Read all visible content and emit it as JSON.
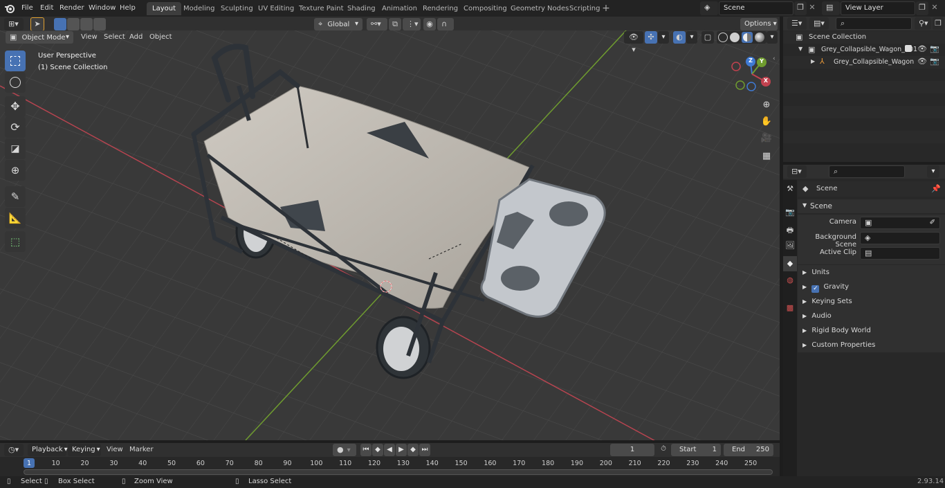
{
  "topbar": {
    "menus": [
      "File",
      "Edit",
      "Render",
      "Window",
      "Help"
    ],
    "workspaces": [
      "Layout",
      "Modeling",
      "Sculpting",
      "UV Editing",
      "Texture Paint",
      "Shading",
      "Animation",
      "Rendering",
      "Compositing",
      "Geometry Nodes",
      "Scripting"
    ],
    "active_workspace": "Layout",
    "scene_name": "Scene",
    "view_layer": "View Layer"
  },
  "viewport_header": {
    "mode": "Object Mode",
    "menus": [
      "View",
      "Select",
      "Add",
      "Object"
    ],
    "transform_orientation": "Global",
    "options_label": "Options"
  },
  "viewport": {
    "overlay_line1": "User Perspective",
    "overlay_line2": "(1) Scene Collection",
    "gizmo_axes": [
      "Z",
      "Y",
      "X"
    ],
    "colors": {
      "x_axis": "#c2424f",
      "y_axis": "#6f9c2f",
      "z_axis": "#3f7ad3",
      "active_tool": "#4772b3"
    }
  },
  "outliner": {
    "root": "Scene Collection",
    "items": [
      {
        "label": "Grey_Collapsible_Wagon_001"
      },
      {
        "label": "Grey_Collapsible_Wagon"
      }
    ]
  },
  "properties": {
    "context_label": "Scene",
    "section": "Scene",
    "fields": [
      {
        "label": "Camera",
        "value": ""
      },
      {
        "label": "Background Scene",
        "value": ""
      },
      {
        "label": "Active Clip",
        "value": ""
      }
    ],
    "panels": [
      "Units",
      "Gravity",
      "Keying Sets",
      "Audio",
      "Rigid Body World",
      "Custom Properties"
    ]
  },
  "timeline": {
    "menus": [
      "Playback",
      "Keying",
      "View",
      "Marker"
    ],
    "current_frame": "1",
    "start_label": "Start",
    "start": "1",
    "end_label": "End",
    "end": "250",
    "ruler": [
      "1",
      "10",
      "20",
      "30",
      "40",
      "50",
      "60",
      "70",
      "80",
      "90",
      "100",
      "110",
      "120",
      "130",
      "140",
      "150",
      "160",
      "170",
      "180",
      "190",
      "200",
      "210",
      "220",
      "230",
      "240",
      "250"
    ]
  },
  "statusbar": {
    "hints": [
      "Select",
      "Box Select",
      "Zoom View",
      "Lasso Select"
    ],
    "version": "2.93.14"
  }
}
